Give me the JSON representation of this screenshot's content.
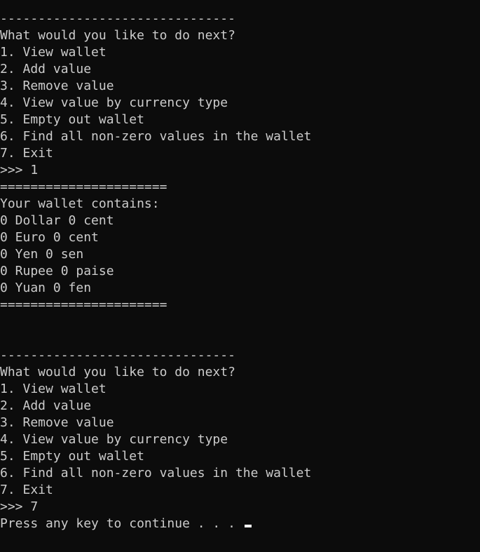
{
  "console": {
    "lines": [
      "-------------------------------",
      "What would you like to do next?",
      "1. View wallet",
      "2. Add value",
      "3. Remove value",
      "4. View value by currency type",
      "5. Empty out wallet",
      "6. Find all non-zero values in the wallet",
      "7. Exit",
      ">>> 1",
      "======================",
      "Your wallet contains:",
      "0 Dollar 0 cent",
      "0 Euro 0 cent",
      "0 Yen 0 sen",
      "0 Rupee 0 paise",
      "0 Yuan 0 fen",
      "======================",
      "",
      "",
      "-------------------------------",
      "What would you like to do next?",
      "1. View wallet",
      "2. Add value",
      "3. Remove value",
      "4. View value by currency type",
      "5. Empty out wallet",
      "6. Find all non-zero values in the wallet",
      "7. Exit",
      ">>> 7",
      "Press any key to continue . . . "
    ],
    "colors": {
      "background": "#0c0c0c",
      "text": "#cccccc",
      "cursor": "#ffffff"
    }
  }
}
